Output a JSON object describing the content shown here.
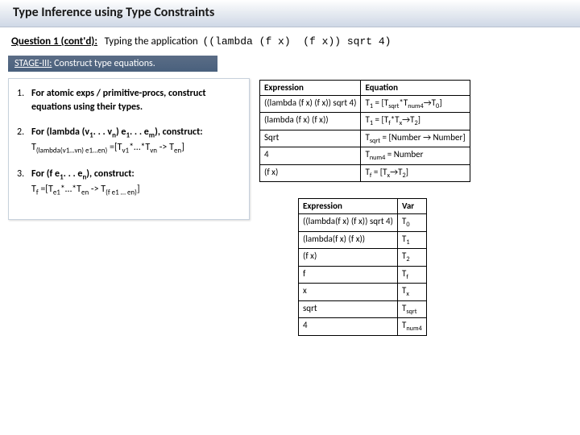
{
  "title": "Type Inference using Type Constraints",
  "question": {
    "label": "Question 1 (cont'd):",
    "text": "Typing the application",
    "code": "((lambda (f x)  (f x)) sqrt 4)"
  },
  "stage": {
    "prefix": "STAGE-III:",
    "text": " Construct type equations."
  },
  "rules": [
    {
      "n": "1.",
      "body_html": "<b>For atomic exps / primitive-procs, construct equations using their types.</b>"
    },
    {
      "n": "2.",
      "body_html": "<b>For (lambda (v<sub>1</sub>. . . v<sub>n</sub>) e<sub>1</sub>. . . e<sub>m</sub>), construct:</b><br>T<sub>(lambda(v1…vn) e1…en)</sub> =[T<sub>v1</sub>*…*T<sub>vn</sub> -&gt; T<sub>en</sub>]"
    },
    {
      "n": "3.",
      "body_html": "<b>For (f e<sub>1</sub>. . . e<sub>n</sub>), construct:</b><br>T<sub>f</sub> =[T<sub>e1</sub>*…*T<sub>en</sub> -&gt; T<sub>(f e1 … en)</sub>]"
    }
  ],
  "eq_table": {
    "headers": [
      "Expression",
      "Equation"
    ],
    "rows": [
      [
        "((lambda (f x) (f x)) sqrt 4)",
        "T<sub>1</sub> = [T<sub>sqrt</sub>*T<sub>num4</sub>→T<sub>0</sub>]"
      ],
      [
        "(lambda (f x) (f x))",
        "T<sub>1</sub> = [T<sub>f</sub>*T<sub>x</sub>→T<sub>2</sub>]"
      ],
      [
        "Sqrt",
        "T<sub>sqrt</sub> = [Number → Number]"
      ],
      [
        "4",
        "T<sub>num4</sub> = Number"
      ],
      [
        "(f x)",
        "T<sub>f</sub> = [T<sub>x</sub>→T<sub>2</sub>]"
      ]
    ]
  },
  "var_table": {
    "headers": [
      "Expression",
      "Var"
    ],
    "rows": [
      [
        "((lambda(f x) (f x)) sqrt 4)",
        "T<sub>0</sub>"
      ],
      [
        "(lambda(f x) (f x))",
        "T<sub>1</sub>"
      ],
      [
        "(f x)",
        "T<sub>2</sub>"
      ],
      [
        "f",
        "T<sub>f</sub>"
      ],
      [
        "x",
        "T<sub>x</sub>"
      ],
      [
        "sqrt",
        "T<sub>sqrt</sub>"
      ],
      [
        "4",
        "T<sub>num4</sub>"
      ]
    ]
  }
}
